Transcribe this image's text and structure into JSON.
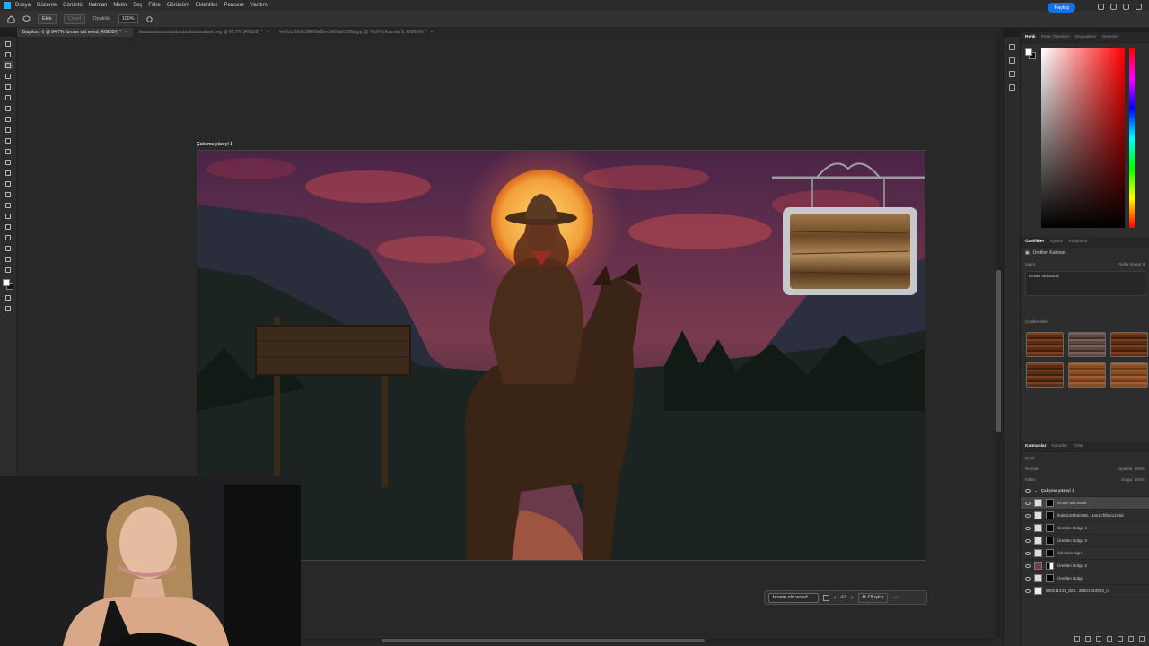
{
  "menu": {
    "items": [
      "Dosya",
      "Düzenle",
      "Görüntü",
      "Katman",
      "Metin",
      "Seç",
      "Filtre",
      "Görünüm",
      "Eklentiler",
      "Pencere",
      "Yardım"
    ]
  },
  "options": {
    "mode_label": "Ekle",
    "mode2_label": "Çıkart",
    "opacity_label": "Opaklık:",
    "opacity_value": "100%",
    "share_label": "Paylaş"
  },
  "tabs": [
    {
      "label": "Başlıksız-1 @ 84,7% (brown old wood, RGB/8#) *",
      "active": true
    },
    {
      "label": "dasdasdasdasdasdasdasdasdasdasd.png @ 66,7% (RGB/8) *",
      "active": false
    },
    {
      "label": "fed6cb28b9c58869a2be1bf0fab1236d.jpg @ 70,8% (Katman 2, RGB/8#) *",
      "active": false
    }
  ],
  "canvas": {
    "artboard_label": "Çalışma yüzeyi 1"
  },
  "gen_bar": {
    "prompt": "brown old wood",
    "count": "4/9",
    "generate_label": "Oluştur"
  },
  "panels": {
    "top_tabs": [
      "Renk",
      "Renk Örnekleri",
      "Degradeler",
      "Desenler"
    ],
    "props_tabs": [
      "Özellikler",
      "Ayarlar",
      "Kitaplıklar"
    ],
    "props_layer_title": "Üretilen Katman",
    "model_label": "Firefly Image 3",
    "prompt_title": "İstem",
    "prompt_text": "brown old wood",
    "variations_title": "Çeşitlemeler",
    "layers_tabs": [
      "Katmanlar",
      "Kanallar",
      "Yollar"
    ],
    "filter_label": "Çeşit",
    "blend_mode": "Normal",
    "opacity_label": "Opaklık:",
    "opacity_value": "100%",
    "lock_label": "Kilitle:",
    "fill_label": "Dolgu:",
    "fill_value": "100%"
  },
  "layers": {
    "group": "Çalışma yüzeyi 1",
    "items": [
      {
        "name": "brown old wood",
        "selected": true,
        "mask": "black"
      },
      {
        "name": "fed6cb28b9c586...3ae1bf0fab1236d",
        "selected": false,
        "mask": "black"
      },
      {
        "name": "Üretilen Dolgu 4",
        "selected": false,
        "mask": "black"
      },
      {
        "name": "Üretilen Dolgu 3",
        "selected": false,
        "mask": "black"
      },
      {
        "name": "old town sign",
        "selected": false,
        "mask": "black"
      },
      {
        "name": "Üretilen Dolgu 2",
        "selected": false,
        "mask": "white"
      },
      {
        "name": "Üretilen Dolgu",
        "selected": false,
        "mask": "black"
      },
      {
        "name": "569211241_823...36601764993_n",
        "selected": false,
        "mask": "none"
      }
    ]
  }
}
